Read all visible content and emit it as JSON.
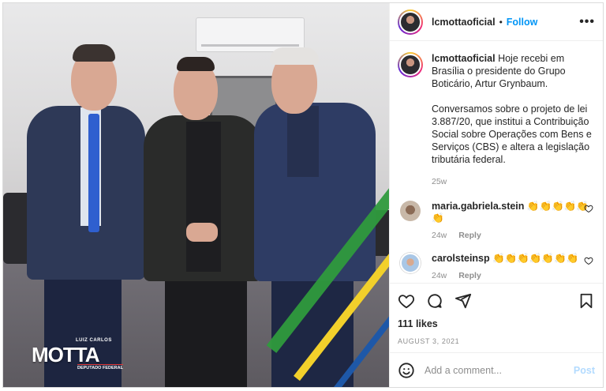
{
  "post": {
    "username": "lcmottaoficial",
    "follow_label": "Follow",
    "more_label": "•••",
    "separator": "•",
    "caption_para1": "Hoje recebi em Brasília o presidente do Grupo Boticário, Artur Grynbaum.",
    "caption_para2": "Conversamos sobre o projeto de lei 3.887/20, que institui a Contribuição Social sobre Operações com Bens e Serviços (CBS) e altera a legislação tributária federal.",
    "caption_time": "25w",
    "likes": "111 likes",
    "date": "AUGUST 3, 2021",
    "add_comment_placeholder": "Add a comment...",
    "post_label": "Post"
  },
  "comments": [
    {
      "username": "maria.gabriela.stein",
      "text": "👏👏👏👏👏👏",
      "time": "24w",
      "reply": "Reply"
    },
    {
      "username": "carolsteinsp",
      "text": "👏👏👏👏👏👏👏",
      "time": "24w",
      "reply": "Reply"
    }
  ],
  "photo": {
    "logo_small": "LUIZ CARLOS",
    "logo_main": "MOTTA",
    "logo_sub": "DEPUTADO FEDERAL"
  },
  "colors": {
    "accent": "#0095f6",
    "post_disabled": "#b3dbff",
    "muted": "#8e8e8e",
    "text": "#262626"
  },
  "icons": [
    "heart-icon",
    "comment-icon",
    "share-icon",
    "bookmark-icon",
    "emoji-icon",
    "more-icon"
  ]
}
